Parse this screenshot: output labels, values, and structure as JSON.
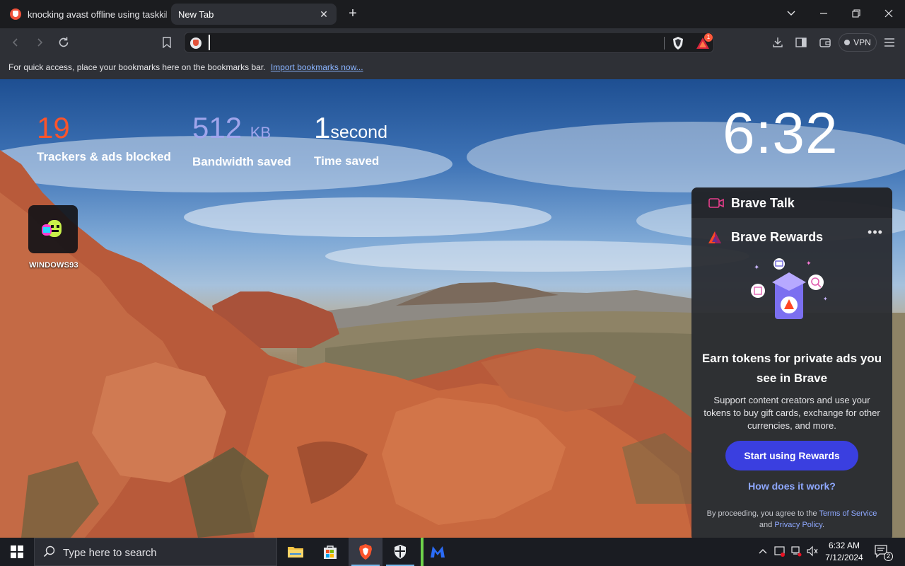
{
  "browser": {
    "tabs": [
      {
        "title": "knocking avast offline using taskkill",
        "active": false
      },
      {
        "title": "New Tab",
        "active": true
      }
    ],
    "address_bar": {
      "value": "",
      "placeholder": ""
    },
    "rewards_badge_count": "1",
    "vpn_label": "VPN",
    "bookmarks_bar": {
      "message": "For quick access, place your bookmarks here on the bookmarks bar.",
      "import_link": "Import bookmarks now..."
    }
  },
  "new_tab": {
    "stats": [
      {
        "value": "19",
        "unit": "",
        "label": "Trackers & ads blocked",
        "color": "#fb542b"
      },
      {
        "value": "512",
        "unit": "KB",
        "label": "Bandwidth saved",
        "color": "#a0a5eb"
      },
      {
        "value": "1",
        "unit": "second",
        "label": "Time saved",
        "color": "#ffffff"
      }
    ],
    "clock": "6:32",
    "top_sites": [
      {
        "label": "WINDOWS93",
        "icon": "windows93-icon"
      }
    ]
  },
  "widgets": {
    "brave_talk": {
      "title": "Brave Talk"
    },
    "brave_rewards": {
      "title": "Brave Rewards",
      "headline": "Earn tokens for private ads you see in Brave",
      "description": "Support content creators and use your tokens to buy gift cards, exchange for other currencies, and more.",
      "cta_label": "Start using Rewards",
      "help_link": "How does it work?",
      "legal_prefix": "By proceeding, you agree to the",
      "terms_link": "Terms of Service",
      "legal_and": "and",
      "privacy_link": "Privacy Policy",
      "legal_suffix": "."
    }
  },
  "taskbar": {
    "search_placeholder": "Type here to search",
    "time": "6:32 AM",
    "date": "7/12/2024",
    "notification_count": "2",
    "apps": [
      "file-explorer",
      "microsoft-store",
      "brave",
      "windows-security",
      "malwarebytes"
    ]
  },
  "colors": {
    "accent": "#3a3fe0",
    "tracker_orange": "#fb542b",
    "bandwidth_purple": "#a0a5eb",
    "link_blue": "#8ea8ff"
  }
}
